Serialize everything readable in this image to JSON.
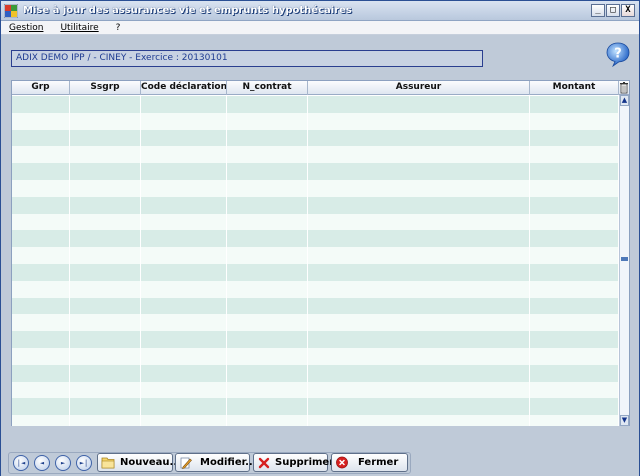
{
  "window": {
    "title": "Mise à jour des assurances vie et emprunts hypothécaires",
    "minimize": "_",
    "maximize": "□",
    "close": "X"
  },
  "menu": {
    "items": [
      {
        "label": "Gestion"
      },
      {
        "label": "Utilitaire"
      },
      {
        "label": "?"
      }
    ]
  },
  "header": {
    "company_info": "ADIX DEMO IPP /     - CINEY - Exercice : 20130101"
  },
  "grid": {
    "columns": [
      {
        "label": "Grp"
      },
      {
        "label": "Ssgrp"
      },
      {
        "label": "Code déclaration"
      },
      {
        "label": "N_contrat"
      },
      {
        "label": "Assureur"
      },
      {
        "label": "Montant"
      }
    ],
    "row_count": 20,
    "row_colors": {
      "even": "#d8ece7",
      "odd": "#f4fbf8"
    }
  },
  "toolbar": {
    "nav": [
      {
        "label": "|◄",
        "icon": "first-record-icon"
      },
      {
        "label": "◄",
        "icon": "previous-record-icon"
      },
      {
        "label": "►",
        "icon": "next-record-icon"
      },
      {
        "label": "►|",
        "icon": "last-record-icon"
      }
    ],
    "new_label": "Nouveau...",
    "edit_label": "Modifier...",
    "delete_label": "Supprimer",
    "close_label": "Fermer"
  },
  "colors": {
    "window_bg": "#bfcad8",
    "company_text": "#1f3c92",
    "accent": "#2a4f94"
  }
}
